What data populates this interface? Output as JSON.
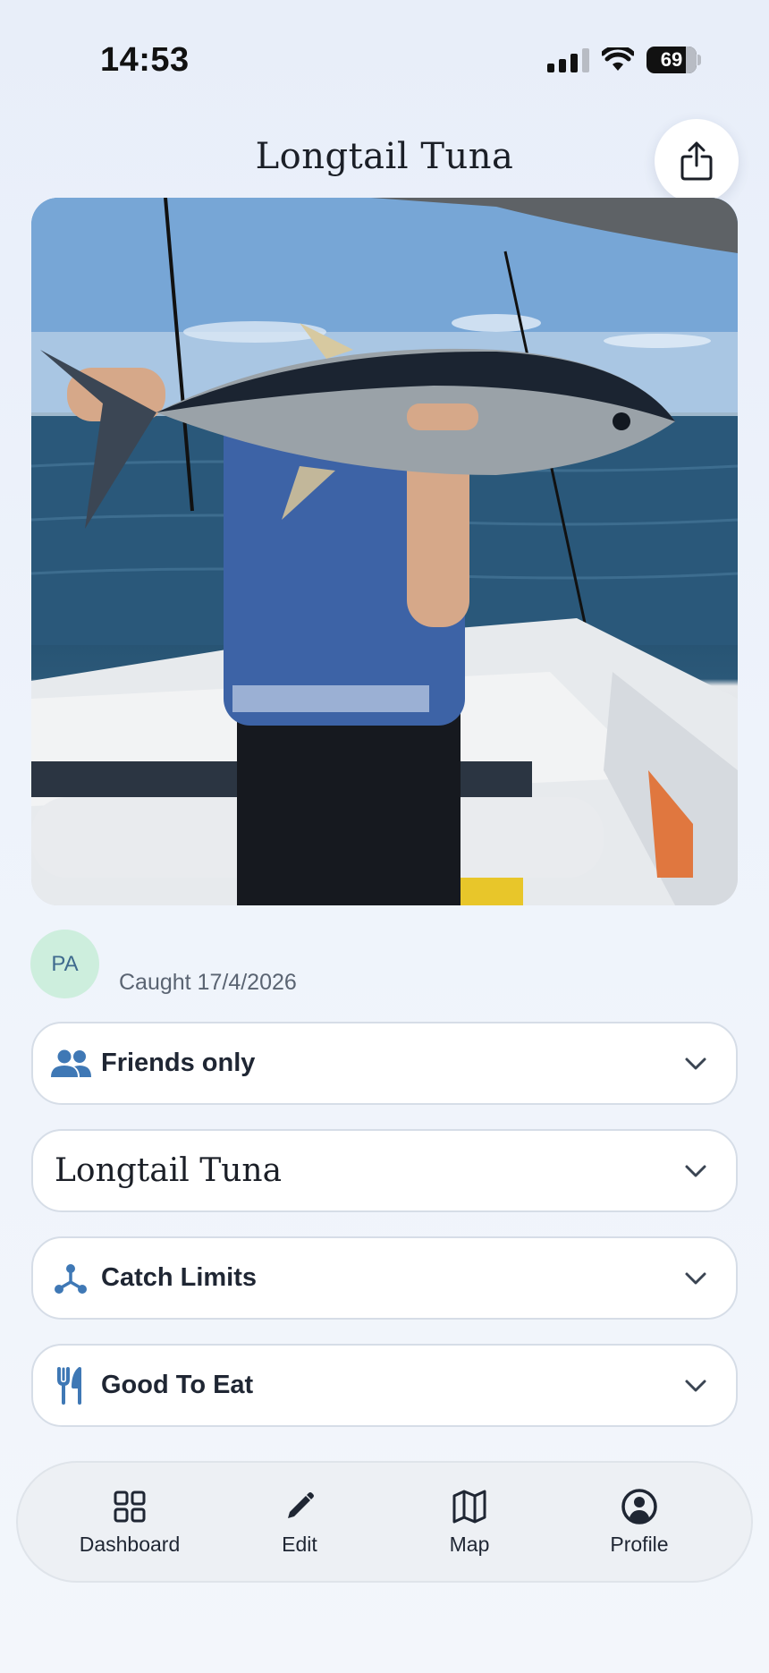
{
  "status_bar": {
    "time": "14:53",
    "battery": "69"
  },
  "header": {
    "title": "Longtail Tuna",
    "share_icon": "share-icon"
  },
  "catch": {
    "photo_alt": "Longtail tuna held on a boat",
    "user_initials": "PA",
    "caught_text": "Caught 17/4/2026"
  },
  "accordions": [
    {
      "label": "Friends only",
      "icon": "friends-icon"
    },
    {
      "label": "Longtail Tuna",
      "icon": ""
    },
    {
      "label": "Catch Limits",
      "icon": "catch-limits-icon"
    },
    {
      "label": "Good To Eat",
      "icon": "cutlery-icon"
    }
  ],
  "nav": [
    {
      "label": "Dashboard",
      "icon": "dashboard-icon"
    },
    {
      "label": "Edit",
      "icon": "pencil-icon"
    },
    {
      "label": "Map",
      "icon": "map-icon"
    },
    {
      "label": "Profile",
      "icon": "profile-icon"
    }
  ],
  "colors": {
    "accent": "#3f78b5",
    "avatar_bg": "#cdeedd",
    "avatar_text": "#3f6a8e"
  }
}
